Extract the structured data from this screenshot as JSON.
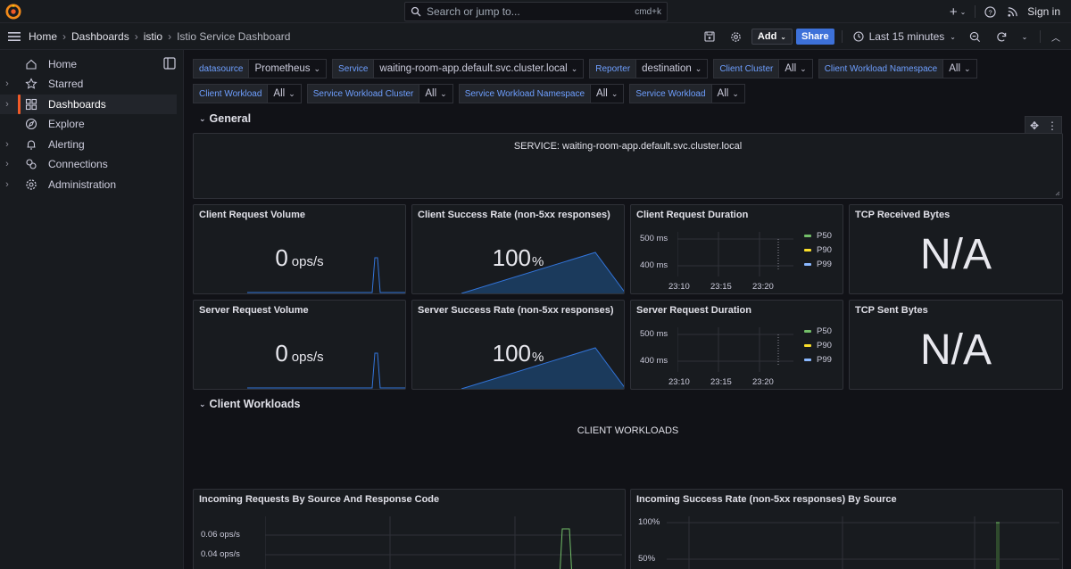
{
  "topbar": {
    "search_placeholder": "Search or jump to...",
    "search_shortcut": "cmd+k",
    "plus_label": "+",
    "signin_label": "Sign in"
  },
  "breadcrumb": {
    "items": [
      "Home",
      "Dashboards",
      "istio",
      "Istio Service Dashboard"
    ]
  },
  "toolbar": {
    "add_label": "Add",
    "share_label": "Share",
    "time_range": "Last 15 minutes"
  },
  "sidebar": {
    "items": [
      {
        "label": "Home",
        "icon": "home-icon",
        "chevron": false
      },
      {
        "label": "Starred",
        "icon": "star-icon",
        "chevron": true
      },
      {
        "label": "Dashboards",
        "icon": "dashboards-icon",
        "chevron": true,
        "active": true
      },
      {
        "label": "Explore",
        "icon": "compass-icon",
        "chevron": false
      },
      {
        "label": "Alerting",
        "icon": "bell-icon",
        "chevron": true
      },
      {
        "label": "Connections",
        "icon": "connections-icon",
        "chevron": true
      },
      {
        "label": "Administration",
        "icon": "gear-icon",
        "chevron": true
      }
    ]
  },
  "variables": {
    "row1": [
      {
        "label": "datasource",
        "value": "Prometheus"
      },
      {
        "label": "Service",
        "value": "waiting-room-app.default.svc.cluster.local"
      },
      {
        "label": "Reporter",
        "value": "destination"
      },
      {
        "label": "Client Cluster",
        "value": "All"
      },
      {
        "label": "Client Workload Namespace",
        "value": "All"
      }
    ],
    "row2": [
      {
        "label": "Client Workload",
        "value": "All"
      },
      {
        "label": "Service Workload Cluster",
        "value": "All"
      },
      {
        "label": "Service Workload Namespace",
        "value": "All"
      },
      {
        "label": "Service Workload",
        "value": "All"
      }
    ]
  },
  "rows": {
    "general": "General",
    "client_workloads": "Client Workloads"
  },
  "service_panel": {
    "text": "SERVICE: waiting-room-app.default.svc.cluster.local"
  },
  "client_workloads_text": "CLIENT WORKLOADS",
  "panels": {
    "client_request_volume": {
      "title": "Client Request Volume",
      "value": "0",
      "unit": "ops/s"
    },
    "client_success_rate": {
      "title": "Client Success Rate (non-5xx responses)",
      "value": "100",
      "unit": "%"
    },
    "client_request_duration": {
      "title": "Client Request Duration"
    },
    "tcp_received": {
      "title": "TCP Received Bytes",
      "value": "N/A"
    },
    "server_request_volume": {
      "title": "Server Request Volume",
      "value": "0",
      "unit": "ops/s"
    },
    "server_success_rate": {
      "title": "Server Success Rate (non-5xx responses)",
      "value": "100",
      "unit": "%"
    },
    "server_request_duration": {
      "title": "Server Request Duration"
    },
    "tcp_sent": {
      "title": "TCP Sent Bytes",
      "value": "N/A"
    },
    "incoming_requests": {
      "title": "Incoming Requests By Source And Response Code",
      "y_ticks": [
        "0.06 ops/s",
        "0.04 ops/s"
      ]
    },
    "incoming_success": {
      "title": "Incoming Success Rate (non-5xx responses) By Source",
      "y_ticks": [
        "100%",
        "50%"
      ]
    }
  },
  "duration_chart": {
    "y_ticks": [
      "500 ms",
      "400 ms"
    ],
    "x_ticks": [
      "23:10",
      "23:15",
      "23:20"
    ],
    "legend": [
      {
        "name": "P50",
        "color": "#73bf69"
      },
      {
        "name": "P90",
        "color": "#fade2a"
      },
      {
        "name": "P99",
        "color": "#8ab8ff"
      }
    ]
  },
  "colors": {
    "accent": "#f05a28",
    "share": "#3d71d9",
    "variable_label": "#6e9fff",
    "spark_line": "#3274d9",
    "spark_fill": "#1b3a5c"
  }
}
